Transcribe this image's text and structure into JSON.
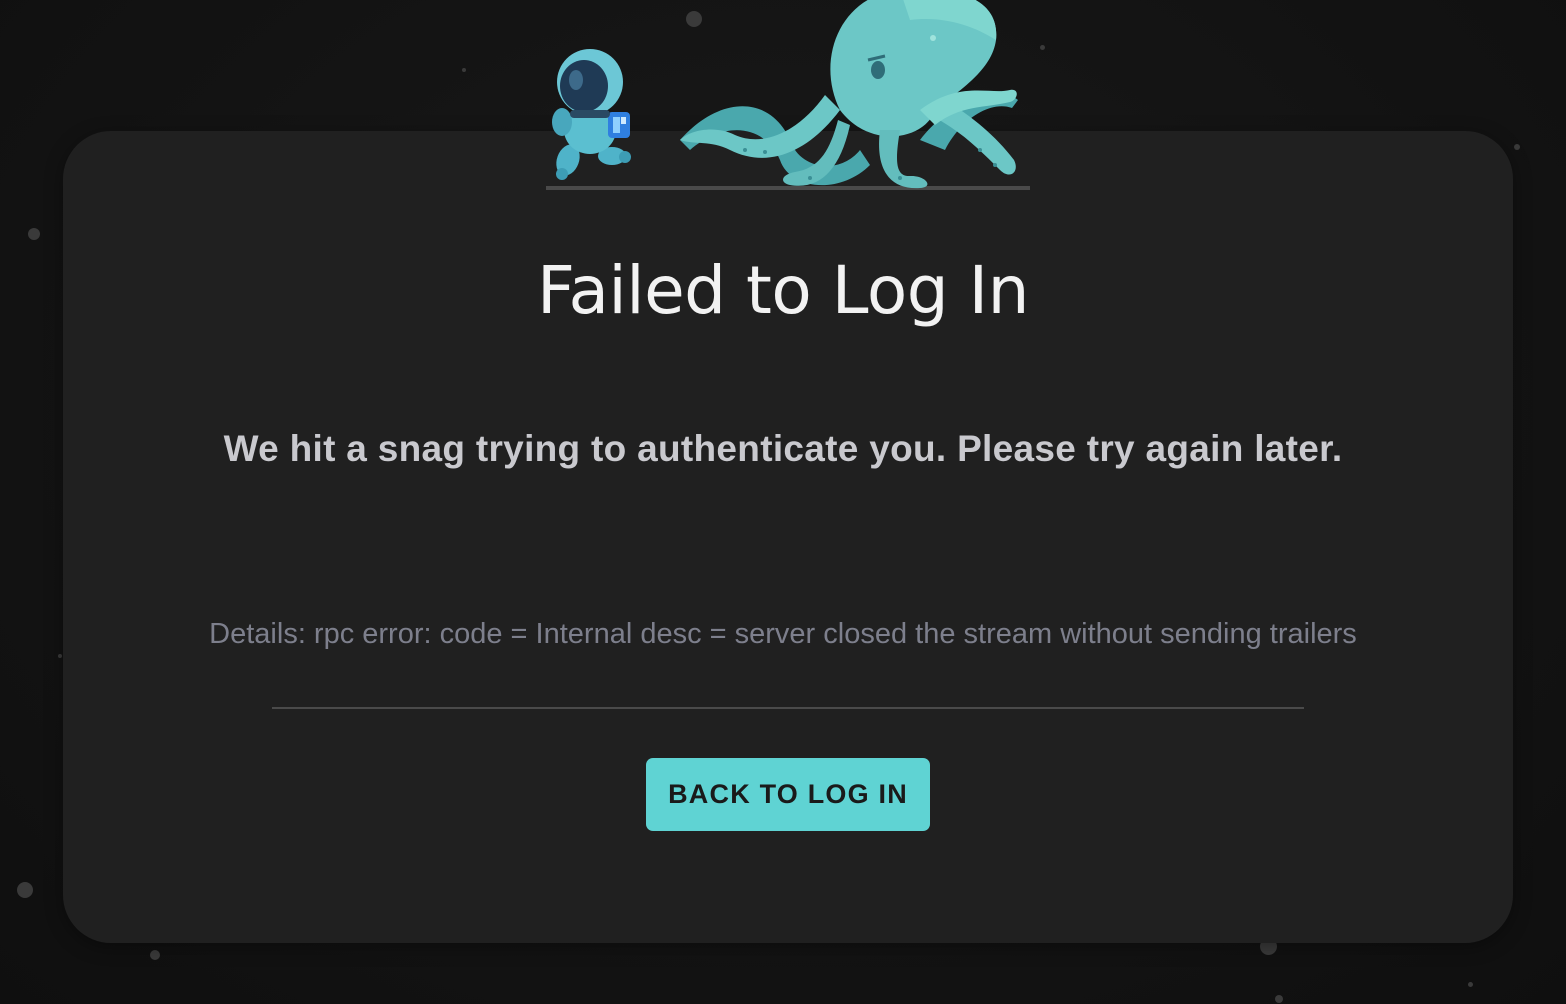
{
  "error": {
    "title": "Failed to Log In",
    "message": "We hit a snag trying to authenticate you. Please try again later.",
    "details": "Details: rpc error: code = Internal desc = server closed the stream without sending trailers"
  },
  "actions": {
    "back_label": "BACK TO LOG IN"
  },
  "illustration": {
    "characters": [
      "astronaut-icon",
      "octopus-icon"
    ]
  },
  "colors": {
    "accent": "#5fd3d3",
    "card_background": "#202020",
    "page_background": "#141414",
    "title_text": "#f2f2f2",
    "message_text": "#c9c9ce",
    "details_text": "#7d7f8c",
    "octopus": "#6cc7c6",
    "astronaut": "#5bbfd0"
  }
}
